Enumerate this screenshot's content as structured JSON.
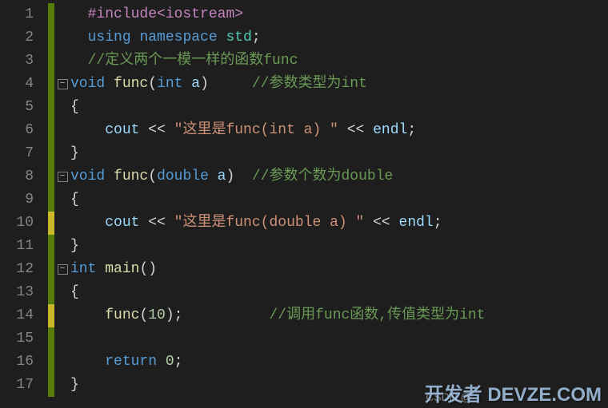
{
  "lineCount": 17,
  "markers": {
    "1": "green",
    "2": "green",
    "3": "green",
    "4": "green",
    "5": "green",
    "6": "green",
    "7": "green",
    "8": "green",
    "9": "green",
    "10": "yellow",
    "11": "green",
    "12": "green",
    "13": "green",
    "14": "yellow",
    "15": "green",
    "16": "green",
    "17": "green"
  },
  "folds": {
    "4": "−",
    "8": "−",
    "12": "−"
  },
  "code": {
    "l1": {
      "indent": "  ",
      "t1": "#include",
      "t2": "<iostream>"
    },
    "l2": {
      "indent": "  ",
      "t1": "using",
      "t2": "namespace",
      "t3": "std",
      "t4": ";"
    },
    "l3": {
      "indent": "  ",
      "t1": "//定义两个一模一样的函数func"
    },
    "l4": {
      "indent": "",
      "t1": "void",
      "t2": "func",
      "t3": "(",
      "t4": "int",
      "t5": " a",
      "t6": ")",
      "gap": "     ",
      "t7": "//参数类型为int"
    },
    "l5": {
      "indent": "",
      "t1": "{"
    },
    "l6": {
      "indent": "    ",
      "t1": "cout",
      "t2": " << ",
      "t3": "\"这里是func(int a) \"",
      "t4": " << ",
      "t5": "endl",
      "t6": ";"
    },
    "l7": {
      "indent": "",
      "t1": "}"
    },
    "l8": {
      "indent": "",
      "t1": "void",
      "t2": "func",
      "t3": "(",
      "t4": "double",
      "t5": " a",
      "t6": ")",
      "gap": "  ",
      "t7": "//参数个数为double"
    },
    "l9": {
      "indent": "",
      "t1": "{"
    },
    "l10": {
      "indent": "    ",
      "t1": "cout",
      "t2": " << ",
      "t3": "\"这里是func(double a) \"",
      "t4": " << ",
      "t5": "endl",
      "t6": ";"
    },
    "l11": {
      "indent": "",
      "t1": "}"
    },
    "l12": {
      "indent": "",
      "t1": "int",
      "t2": "main",
      "t3": "()"
    },
    "l13": {
      "indent": "",
      "t1": "{"
    },
    "l14": {
      "indent": "    ",
      "t1": "func",
      "t2": "(",
      "t3": "10",
      "t4": ");",
      "gap": "          ",
      "t5": "//调用func函数,传值类型为int"
    },
    "l15": {
      "indent": ""
    },
    "l16": {
      "indent": "    ",
      "t1": "return",
      "t2": " ",
      "t3": "0",
      "t4": ";"
    },
    "l17": {
      "indent": "",
      "t1": "}"
    }
  },
  "watermark1": "CSDN @",
  "watermark2": "开发者\nDEVZE.COM"
}
